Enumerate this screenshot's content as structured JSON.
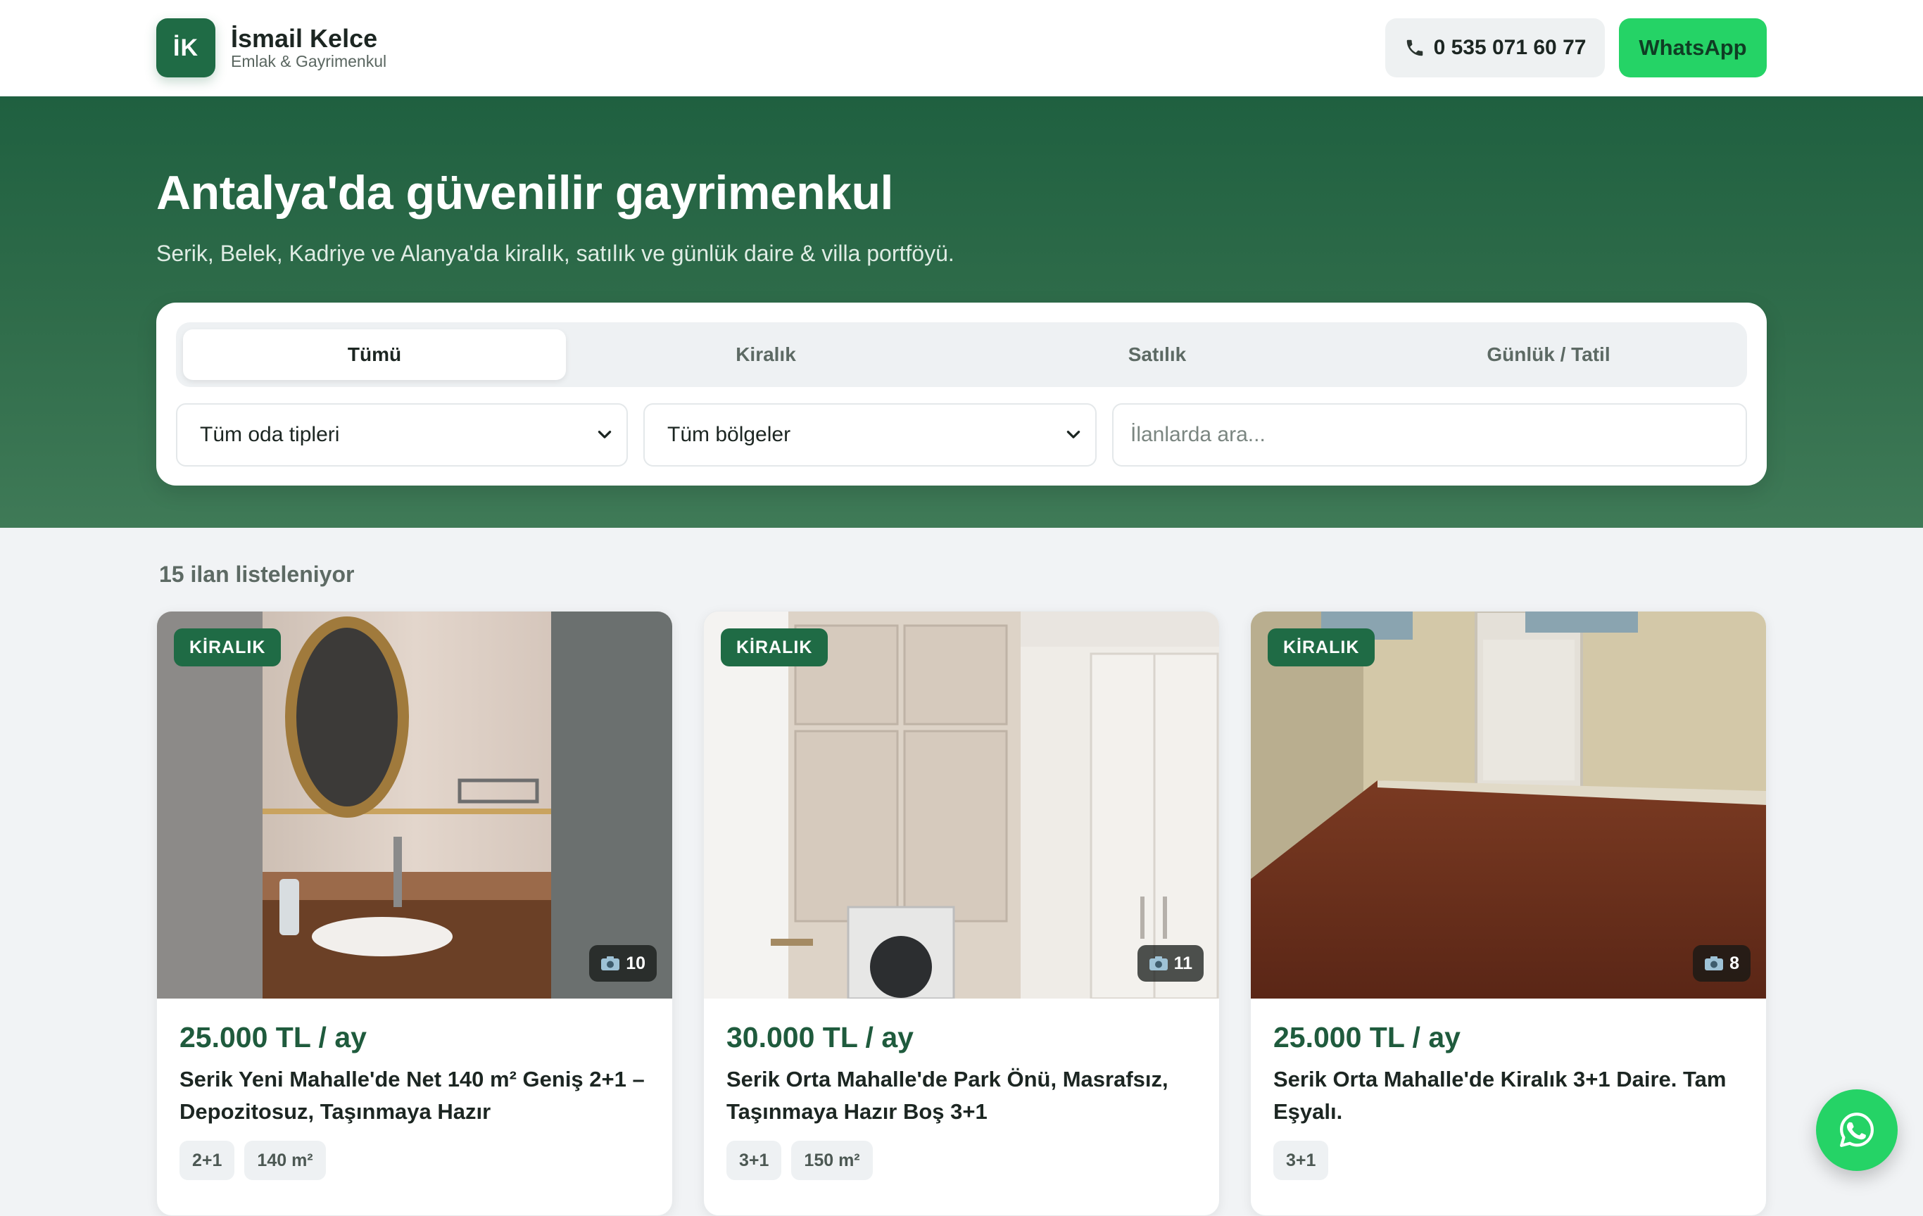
{
  "brand": {
    "initials": "İK",
    "name": "İsmail Kelce",
    "subtitle": "Emlak & Gayrimenkul"
  },
  "header": {
    "phone": "0 535 071 60 77",
    "whatsapp_label": "WhatsApp"
  },
  "hero": {
    "title": "Antalya'da güvenilir gayrimenkul",
    "subtitle": "Serik, Belek, Kadriye ve Alanya'da kiralık, satılık ve günlük daire & villa portföyü."
  },
  "search": {
    "tabs": [
      {
        "label": "Tümü",
        "active": true
      },
      {
        "label": "Kiralık",
        "active": false
      },
      {
        "label": "Satılık",
        "active": false
      },
      {
        "label": "Günlük / Tatil",
        "active": false
      }
    ],
    "room_select": "Tüm oda tipleri",
    "region_select": "Tüm bölgeler",
    "placeholder": "İlanlarda ara..."
  },
  "listing_count": "15 ilan listeleniyor",
  "listings": [
    {
      "badge": "KİRALIK",
      "photos": "10",
      "price": "25.000 TL / ay",
      "title": "Serik Yeni Mahalle'de Net 140 m² Geniş 2+1 – Depozitosuz, Taşınmaya Hazır",
      "chips": [
        "2+1",
        "140 m²"
      ]
    },
    {
      "badge": "KİRALIK",
      "photos": "11",
      "price": "30.000 TL / ay",
      "title": "Serik Orta Mahalle'de Park Önü, Masrafsız, Taşınmaya Hazır Boş 3+1",
      "chips": [
        "3+1",
        "150 m²"
      ]
    },
    {
      "badge": "KİRALIK",
      "photos": "8",
      "price": "25.000 TL / ay",
      "title": "Serik Orta Mahalle'de Kiralık 3+1 Daire. Tam Eşyalı.",
      "chips": [
        "3+1"
      ]
    }
  ],
  "colors": {
    "brand_green": "#1f6b45",
    "whatsapp_green": "#25d366",
    "hero_green": "#2f6c4a"
  }
}
